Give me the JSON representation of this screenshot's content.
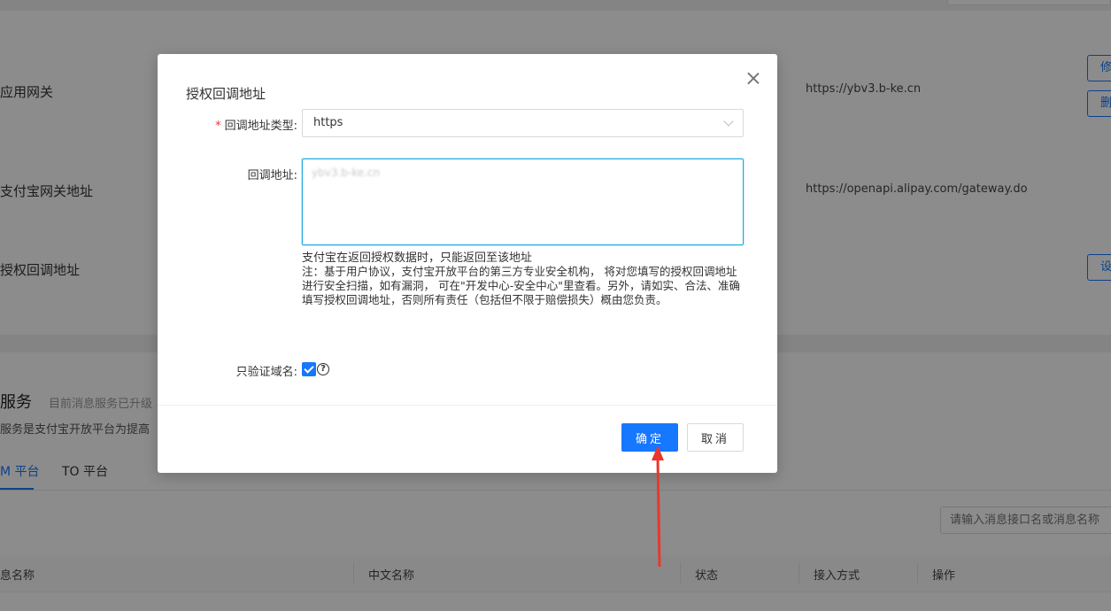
{
  "background": {
    "rows": [
      {
        "label": "应用网关",
        "value": "https://ybv3.b-ke.cn"
      },
      {
        "label": "支付宝网关地址",
        "value": "https://openapi.alipay.com/gateway.do"
      },
      {
        "label": "授权回调地址",
        "value": ""
      }
    ],
    "edge_buttons": [
      "修",
      "删",
      "设"
    ],
    "section_title": "服务",
    "section_subtitle": "目前消息服务已升级",
    "section_desc": "服务是支付宝开放平台为提高",
    "tabs": [
      "M 平台",
      "TO 平台"
    ],
    "search_placeholder": "请输入消息接口名或消息名称",
    "table_headers": [
      "息名称",
      "中文名称",
      "状态",
      "接入方式",
      "操作"
    ]
  },
  "modal": {
    "title": "授权回调地址",
    "fields": {
      "type_label": "回调地址类型:",
      "type_value": "https",
      "url_label": "回调地址:",
      "url_value": "ybv3.b-ke.cn",
      "help_text": "支付宝在返回授权数据时，只能返回至该地址",
      "note_text": "注：基于用户协议，支付宝开放平台的第三方专业安全机构， 将对您填写的授权回调地址进行安全扫描，如有漏洞， 可在\"开发中心-安全中心\"里查看。另外，请如实、合法、准确填写授权回调地址，否则所有责任（包括但不限于赔偿损失）概由您负责。",
      "verify_label": "只验证域名:",
      "verify_checked": true
    },
    "confirm_label": "确定",
    "cancel_label": "取消"
  },
  "colors": {
    "primary": "#1677ff",
    "annotation_arrow": "#e8382d"
  }
}
